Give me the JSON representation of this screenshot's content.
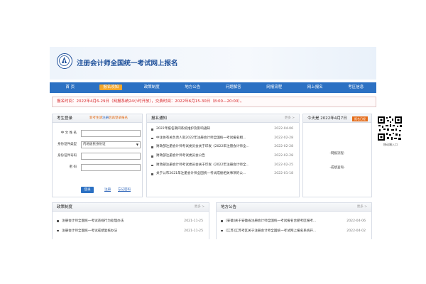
{
  "site": {
    "title": "注册会计师全国统一考试网上报名"
  },
  "nav": [
    {
      "label": "首 页",
      "active": false
    },
    {
      "label": "报名须知",
      "active": true
    },
    {
      "label": "政策制度",
      "active": false
    },
    {
      "label": "地方公告",
      "active": false
    },
    {
      "label": "问题解答",
      "active": false
    },
    {
      "label": "网报流程",
      "active": false
    },
    {
      "label": "网上报名",
      "active": false
    },
    {
      "label": "考区信息",
      "active": false
    }
  ],
  "notice": {
    "text": "报名时间：2022年4月6-29日（网报系统24小时开放），交费时间：2022年6月15-30日（8:00—20:00）。"
  },
  "login": {
    "title": "考生登录",
    "link_new": "新考生请",
    "link_register": "注册",
    "link_tail": "后再登录报名",
    "fields": [
      {
        "label": "中  文  姓  名",
        "value": ""
      },
      {
        "label": "身份证件类型",
        "value": "内地居民身份证"
      },
      {
        "label": "身份证件号码",
        "value": ""
      },
      {
        "label": "密          码",
        "value": ""
      }
    ],
    "submit": "登录",
    "register": "注册",
    "forgot": "忘记密码"
  },
  "notices_panel": {
    "title": "报名通知",
    "more": "更多 >",
    "items": [
      {
        "title": "2022年报名期间系统维护及影响通知",
        "date": "2022-04-06"
      },
      {
        "title": "中注协有关负责人就2022年注册会计师全国统一考试报名相...",
        "date": "2022-02-28"
      },
      {
        "title": "财政部注册会计师考试委员会关于印发《2022年注册会计师全...",
        "date": "2022-02-28"
      },
      {
        "title": "财政部注册会计师考试委员会公告",
        "date": "2022-02-28"
      },
      {
        "title": "财政部注册会计师考试委员会关于印发《2022年注册会计师全...",
        "date": "2022-02-25"
      },
      {
        "title": "关于公布2021年注册会计师全国统一考试成绩相关事项的公...",
        "date": "2022-01-18"
      }
    ]
  },
  "calendar": {
    "title": "今天是 2022年4月7日",
    "link": "报名日程",
    "items": [
      "-网报流程-",
      "-成绩查询-"
    ]
  },
  "qr": {
    "caption": "移动端入口"
  },
  "policy_panel": {
    "title": "政策制度",
    "more": "更多 >",
    "items": [
      {
        "title": "注册会计师全国统一考试违规行为处理办法",
        "date": "2021-11-25"
      },
      {
        "title": "注册会计师全国统一考试成绩复核办法",
        "date": "2021-11-25"
      }
    ]
  },
  "local_panel": {
    "title": "地方公告",
    "more": "更多 >",
    "items": [
      {
        "title": "[安徽]关于安徽省注册会计师全国统一考试报名合肥考区报考...",
        "date": "2022-04-06"
      },
      {
        "title": "[江苏]江苏考区关于注册会计师全国统一考试网上报名系统开...",
        "date": "2022-04-02"
      }
    ]
  },
  "colors": {
    "primary": "#2c71c3",
    "accent": "#f3a72c",
    "alert": "#d8262a"
  }
}
